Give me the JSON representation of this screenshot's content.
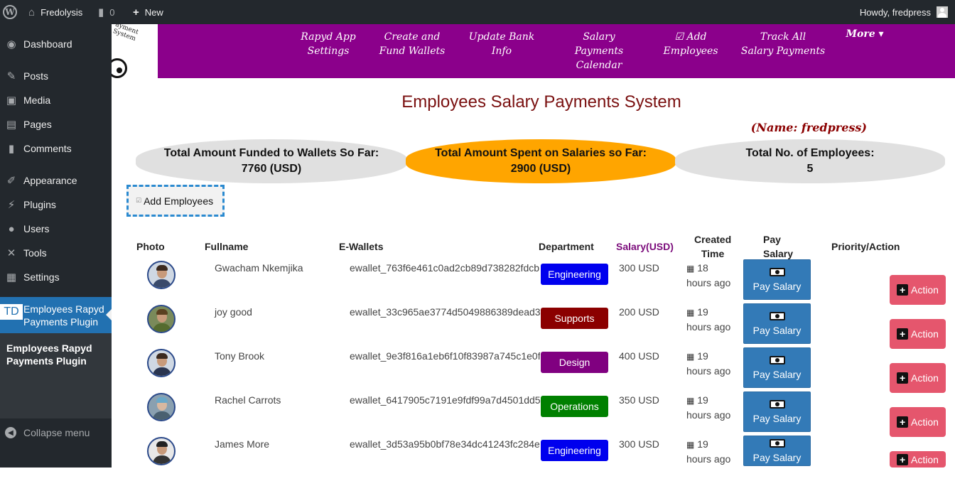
{
  "admin_bar": {
    "site_name": "Fredolysis",
    "comments_count": "0",
    "new_label": "New",
    "howdy": "Howdy, fredpress"
  },
  "sidebar": {
    "items": [
      {
        "label": "Dashboard",
        "icon": "dashboard-icon"
      },
      {
        "label": "Posts",
        "icon": "pin-icon"
      },
      {
        "label": "Media",
        "icon": "media-icon"
      },
      {
        "label": "Pages",
        "icon": "pages-icon"
      },
      {
        "label": "Comments",
        "icon": "comment-icon"
      },
      {
        "label": "Appearance",
        "icon": "brush-icon"
      },
      {
        "label": "Plugins",
        "icon": "plug-icon"
      },
      {
        "label": "Users",
        "icon": "user-icon"
      },
      {
        "label": "Tools",
        "icon": "wrench-icon"
      },
      {
        "label": "Settings",
        "icon": "sliders-icon"
      }
    ],
    "active": {
      "badge": "TD",
      "label_line1": "Employees Rapyd",
      "label_line2": "Payments Plugin"
    },
    "submenu": {
      "line1": "Employees Rapyd",
      "line2": "Payments Plugin"
    },
    "collapse_label": "Collapse menu"
  },
  "logo": {
    "text1": "ayment System",
    "text2": "System"
  },
  "nav": {
    "links": [
      {
        "line1": "Rapyd App",
        "line2": "Settings"
      },
      {
        "line1": "Create and",
        "line2": "Fund Wallets"
      },
      {
        "line1": "Update Bank",
        "line2": "Info"
      },
      {
        "line1": "Salary Payments",
        "line2": "Calendar"
      },
      {
        "line1": "☑ Add",
        "line2": "Employees"
      },
      {
        "line1": "Track All",
        "line2": "Salary Payments"
      }
    ],
    "more": "More ▾"
  },
  "page": {
    "title": "Employees Salary Payments System",
    "name_tag": "(Name: fredpress)"
  },
  "stats": {
    "funded_label": "Total Amount Funded to Wallets So Far:",
    "funded_value": "7760 (USD)",
    "spent_label": "Total Amount Spent on Salaries so Far:",
    "spent_value": "2900 (USD)",
    "employees_label": "Total No. of Employees:",
    "employees_value": "5"
  },
  "add_employees_label": "Add Employees",
  "table": {
    "headers": {
      "photo": "Photo",
      "fullname": "Fullname",
      "wallets": "E-Wallets",
      "department": "Department",
      "salary": "Salary(USD)",
      "created_l1": "Created",
      "created_l2": "Time",
      "pay_l1": "Pay",
      "pay_l2": "Salary",
      "priority": "Priority/Action"
    },
    "rows": [
      {
        "name": "Gwacham Nkemjika",
        "wallet": "ewallet_763f6e461c0ad2cb89d738282fdcb",
        "department": "Engineering",
        "dept_color": "#0000ee",
        "salary": "300 USD",
        "created_l1": "18",
        "created_l2": "hours ago",
        "pay": "Pay Salary",
        "action": "Action"
      },
      {
        "name": "joy good",
        "wallet": "ewallet_33c965ae3774d5049886389dead3",
        "department": "Supports",
        "dept_color": "#8b0000",
        "salary": "200 USD",
        "created_l1": "19",
        "created_l2": "hours ago",
        "pay": "Pay Salary",
        "action": "Action"
      },
      {
        "name": "Tony Brook",
        "wallet": "ewallet_9e3f816a1eb6f10f83987a745c1e0f",
        "department": "Design",
        "dept_color": "#800080",
        "salary": "400 USD",
        "created_l1": "19",
        "created_l2": "hours ago",
        "pay": "Pay Salary",
        "action": "Action"
      },
      {
        "name": "Rachel Carrots",
        "wallet": "ewallet_6417905c7191e9fdf99a7d4501dd5",
        "department": "Operations",
        "dept_color": "#008000",
        "salary": "350 USD",
        "created_l1": "19",
        "created_l2": "hours ago",
        "pay": "Pay Salary",
        "action": "Action"
      },
      {
        "name": "James More",
        "wallet": "ewallet_3d53a95b0bf78e34dc41243fc284e",
        "department": "Engineering",
        "dept_color": "#0000ee",
        "salary": "300 USD",
        "created_l1": "19",
        "created_l2": "hours ago",
        "pay": "Pay Salary",
        "action": "Action"
      }
    ]
  },
  "colors": {
    "nav_bg": "#8b008b",
    "admin_bg": "#23282d",
    "active_menu": "#2271b1",
    "spent_bg": "#ffa500",
    "pay_btn": "#337ab7",
    "action_btn": "#e5566d"
  }
}
